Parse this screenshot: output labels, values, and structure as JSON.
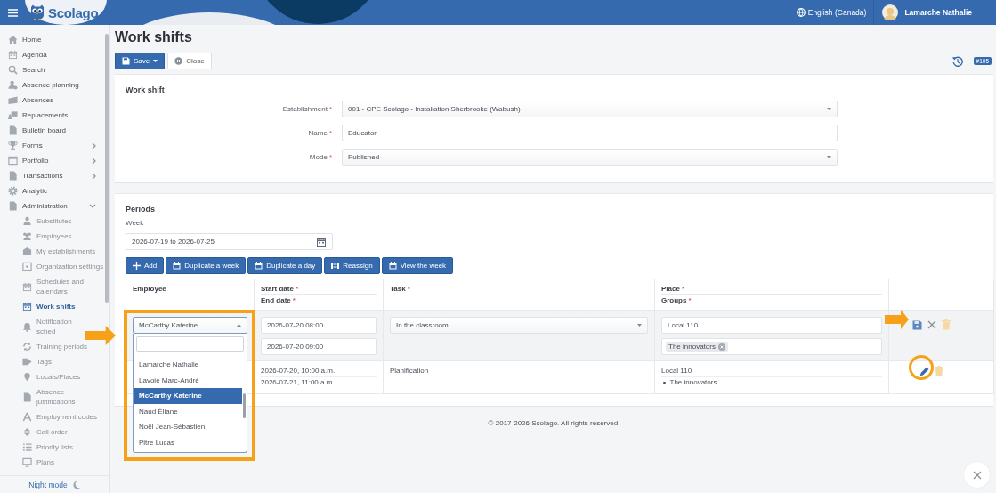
{
  "header": {
    "logo": "Scolago",
    "language": "English (Canada)",
    "user": "Lamarche Nathalie"
  },
  "sidebar": {
    "items": [
      {
        "label": "Home",
        "selected": false
      },
      {
        "label": "Agenda",
        "selected": false
      },
      {
        "label": "Search",
        "selected": false
      },
      {
        "label": "Absence planning",
        "selected": false
      },
      {
        "label": "Absences",
        "selected": false
      },
      {
        "label": "Replacements",
        "selected": false
      },
      {
        "label": "Bulletin board",
        "selected": false
      },
      {
        "label": "Forms",
        "selected": false,
        "expanded": false
      },
      {
        "label": "Portfolio",
        "selected": false,
        "expanded": false
      },
      {
        "label": "Transactions",
        "selected": false,
        "expanded": false
      },
      {
        "label": "Analytic",
        "selected": false
      },
      {
        "label": "Administration",
        "selected": false,
        "expanded": true,
        "children": [
          {
            "label": "Substitutes",
            "selected": false
          },
          {
            "label": "Employees",
            "selected": false
          },
          {
            "label": "My establishments",
            "selected": false
          },
          {
            "label": "Organization settings",
            "selected": false
          },
          {
            "label": "Schedules and calendars",
            "selected": false
          },
          {
            "label": "Work shifts",
            "selected": true
          },
          {
            "label": "Notification\nsched",
            "selected": false
          },
          {
            "label": "Training periods",
            "selected": false
          },
          {
            "label": "Tags",
            "selected": false
          },
          {
            "label": "Locals/Places",
            "selected": false
          },
          {
            "label": "Absence justifications",
            "selected": false
          },
          {
            "label": "Employment codes",
            "selected": false
          },
          {
            "label": "Call order",
            "selected": false
          },
          {
            "label": "Priority lists",
            "selected": false
          },
          {
            "label": "Plans",
            "selected": false
          }
        ]
      }
    ],
    "night_mode": "Night mode"
  },
  "page": {
    "title": "Work shifts",
    "actions": [
      {
        "label": "Save",
        "kind": "primary"
      },
      {
        "label": "Close",
        "kind": "default"
      }
    ],
    "badge": "#105"
  },
  "work_shift": {
    "title": "Work shift",
    "fields": [
      {
        "label": "Establishment",
        "required_mark": "*",
        "kind": "select",
        "value": "001 - CPE Scolago - Installation Sherbrooke (Wabush)"
      },
      {
        "label": "Name",
        "required_mark": "*",
        "kind": "text",
        "value": "Educator"
      },
      {
        "label": "Mode",
        "required_mark": "*",
        "kind": "select",
        "value": "Published"
      }
    ]
  },
  "periods": {
    "title": "Periods",
    "week_label": "Week",
    "week_value": "2026-07-19 to 2026-07-25",
    "buttons": [
      {
        "label": "Add",
        "kind": "add"
      },
      {
        "label": "Duplicate a week",
        "kind": "calendar"
      },
      {
        "label": "Duplicate a day",
        "kind": "calendar"
      },
      {
        "label": "Reassign",
        "kind": "reassign"
      },
      {
        "label": "View the week",
        "kind": "calendar"
      }
    ],
    "table": {
      "columns": [
        {
          "lines": [
            {
              "label": "Employee"
            }
          ]
        },
        {
          "lines": [
            {
              "label": "Start date",
              "required_mark": "*"
            },
            {
              "label": "End date",
              "required_mark": "*"
            }
          ]
        },
        {
          "lines": [
            {
              "label": "Task",
              "required_mark": "*"
            }
          ]
        },
        {
          "lines": [
            {
              "label": "Place",
              "required_mark": "*"
            },
            {
              "label": "Groups",
              "required_mark": "*"
            }
          ]
        },
        {}
      ],
      "rows": [
        {
          "kind": "edit",
          "employee": "McCarthy Katerine",
          "start": "2026-07-20 08:00",
          "end": "2026-07-20 09:00",
          "task": "In the classroom",
          "place": "Local 110",
          "groups": [
            "The innovators"
          ],
          "employee_options": [
            {
              "label": "Lamarche Nathalie",
              "selected": false
            },
            {
              "label": "Lavoie Marc-André",
              "selected": false
            },
            {
              "label": "McCarthy Katerine",
              "selected": true
            },
            {
              "label": "Naud Éliane",
              "selected": false
            },
            {
              "label": "Noël Jean-Sébastien",
              "selected": false
            },
            {
              "label": "Pitre Lucas",
              "selected": false
            }
          ]
        },
        {
          "kind": "view",
          "start": "2026-07-20, 10:00 a.m.",
          "end": "2026-07-21, 11:00 a.m.",
          "task": "Planification",
          "place": "Local 110",
          "groups": [
            "The innovators"
          ]
        }
      ]
    }
  },
  "footer": "© 2017-2026 Scolago. All rights reserved."
}
